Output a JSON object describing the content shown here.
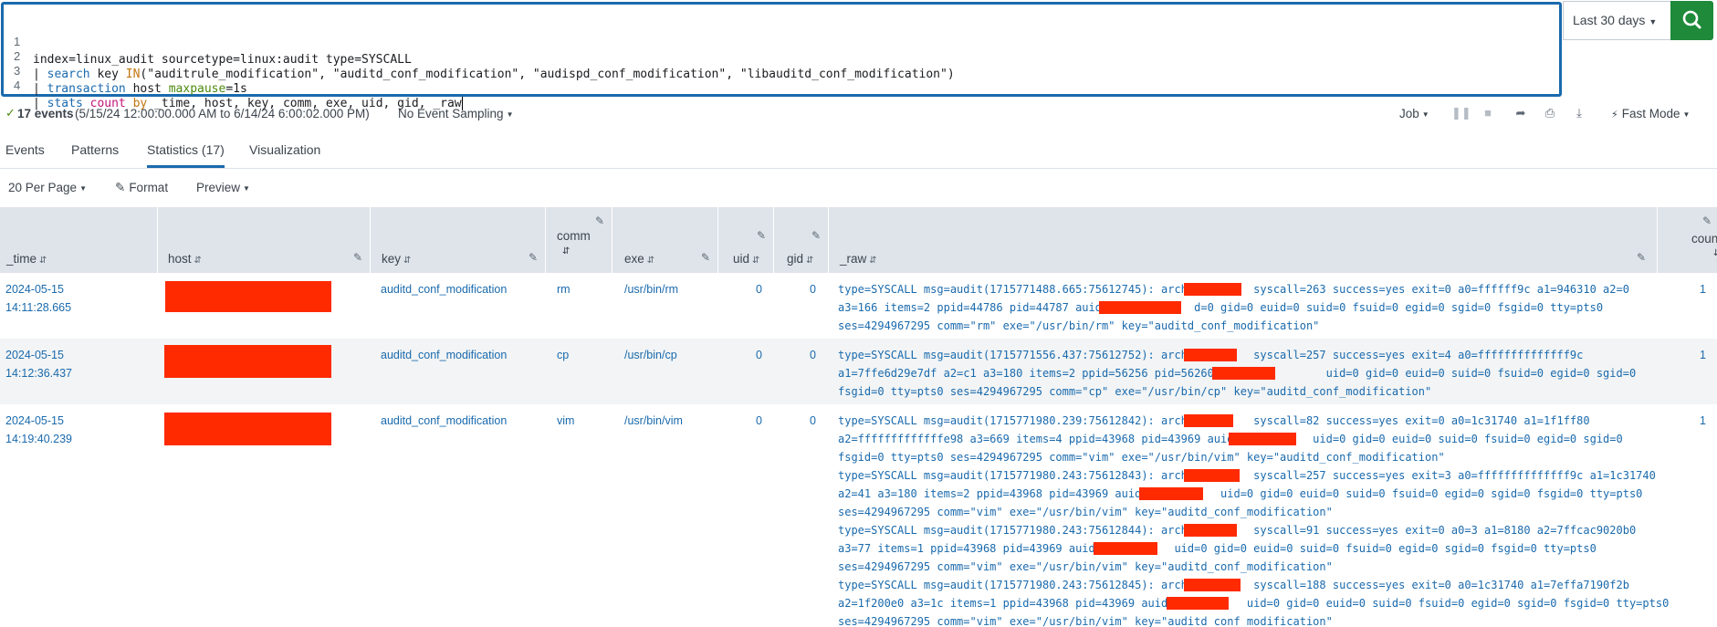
{
  "search": {
    "lines": [
      {
        "n": "1",
        "parts": [
          {
            "t": "index=linux_audit sourcetype=linux:audit type=SYSCALL",
            "c": ""
          }
        ]
      },
      {
        "n": "2",
        "parts": [
          {
            "t": "| ",
            "c": ""
          },
          {
            "t": "search",
            "c": "kw-blue"
          },
          {
            "t": " key ",
            "c": ""
          },
          {
            "t": "IN",
            "c": "kw-orange"
          },
          {
            "t": "(\"auditrule_modification\", \"auditd_conf_modification\", \"audispd_conf_modification\", \"libauditd_conf_modification\")",
            "c": ""
          }
        ]
      },
      {
        "n": "3",
        "parts": [
          {
            "t": "| ",
            "c": ""
          },
          {
            "t": "transaction",
            "c": "kw-blue"
          },
          {
            "t": " host ",
            "c": ""
          },
          {
            "t": "maxpause",
            "c": "kw-green"
          },
          {
            "t": "=1s",
            "c": ""
          }
        ]
      },
      {
        "n": "4",
        "parts": [
          {
            "t": "| ",
            "c": ""
          },
          {
            "t": "stats",
            "c": "kw-blue"
          },
          {
            "t": " ",
            "c": ""
          },
          {
            "t": "count",
            "c": "kw-pink"
          },
          {
            "t": " ",
            "c": ""
          },
          {
            "t": "by",
            "c": "kw-orange"
          },
          {
            "t": " _time, host, key, comm, exe, uid, gid, _raw",
            "c": ""
          }
        ]
      }
    ],
    "time_range_label": "Last 30 days",
    "search_icon": "search-icon"
  },
  "status": {
    "events_count": "17 events",
    "range_text": "(5/15/24 12:00:00.000 AM to 6/14/24 6:00:02.000 PM)",
    "sampling_label": "No Event Sampling",
    "job_label": "Job",
    "mode_label": "Fast Mode"
  },
  "tabs": [
    {
      "label": "Events",
      "active": false
    },
    {
      "label": "Patterns",
      "active": false
    },
    {
      "label": "Statistics (17)",
      "active": true
    },
    {
      "label": "Visualization",
      "active": false
    }
  ],
  "controls": {
    "per_page": "20 Per Page",
    "format": "Format",
    "preview": "Preview"
  },
  "table": {
    "columns": [
      "_time",
      "host",
      "key",
      "comm",
      "exe",
      "uid",
      "gid",
      "_raw",
      "count"
    ],
    "rows": [
      {
        "time": [
          "2024-05-15",
          "14:11:28.665"
        ],
        "key": "auditd_conf_modification",
        "comm": "rm",
        "exe": "/usr/bin/rm",
        "uid": "0",
        "gid": "0",
        "raw": [
          "type=SYSCALL msg=audit(1715771488.665:75612745): arch=         syscall=263 success=yes exit=0 a0=ffffff9c a1=946310 a2=0",
          "a3=166 items=2 ppid=44786 pid=44787 auid=             d=0 gid=0 euid=0 suid=0 fsuid=0 egid=0 sgid=0 fsgid=0 tty=pts0",
          "ses=4294967295 comm=\"rm\" exe=\"/usr/bin/rm\" key=\"auditd_conf_modification\""
        ],
        "count": "1"
      },
      {
        "time": [
          "2024-05-15",
          "14:12:36.437"
        ],
        "key": "auditd_conf_modification",
        "comm": "cp",
        "exe": "/usr/bin/cp",
        "uid": "0",
        "gid": "0",
        "raw": [
          "type=SYSCALL msg=audit(1715771556.437:75612752): arch=         syscall=257 success=yes exit=4 a0=ffffffffffffff9c",
          "a1=7ffe6d29e7df a2=c1 a3=180 items=2 ppid=56256 pid=56260 auid=           uid=0 gid=0 euid=0 suid=0 fsuid=0 egid=0 sgid=0",
          "fsgid=0 tty=pts0 ses=4294967295 comm=\"cp\" exe=\"/usr/bin/cp\" key=\"auditd_conf_modification\""
        ],
        "count": "1"
      },
      {
        "time": [
          "2024-05-15",
          "14:19:40.239"
        ],
        "key": "auditd_conf_modification",
        "comm": "vim",
        "exe": "/usr/bin/vim",
        "uid": "0",
        "gid": "0",
        "raw": [
          "type=SYSCALL msg=audit(1715771980.239:75612842): arch=         syscall=82 success=yes exit=0 a0=1c31740 a1=1f1ff80",
          "a2=fffffffffffffe98 a3=669 items=4 ppid=43968 pid=43969 auid=           uid=0 gid=0 euid=0 suid=0 fsuid=0 egid=0 sgid=0",
          "fsgid=0 tty=pts0 ses=4294967295 comm=\"vim\" exe=\"/usr/bin/vim\" key=\"auditd_conf_modification\"",
          "type=SYSCALL msg=audit(1715771980.243:75612843): arch=         syscall=257 success=yes exit=3 a0=ffffffffffffff9c a1=1c31740",
          "a2=41 a3=180 items=2 ppid=43968 pid=43969 auid=           uid=0 gid=0 euid=0 suid=0 fsuid=0 egid=0 sgid=0 fsgid=0 tty=pts0",
          "ses=4294967295 comm=\"vim\" exe=\"/usr/bin/vim\" key=\"auditd_conf_modification\"",
          "type=SYSCALL msg=audit(1715771980.243:75612844): arch=         syscall=91 success=yes exit=0 a0=3 a1=8180 a2=7ffcac9020b0",
          "a3=77 items=1 ppid=43968 pid=43969 auid=           uid=0 gid=0 euid=0 suid=0 fsuid=0 egid=0 sgid=0 fsgid=0 tty=pts0",
          "ses=4294967295 comm=\"vim\" exe=\"/usr/bin/vim\" key=\"auditd_conf_modification\"",
          "type=SYSCALL msg=audit(1715771980.243:75612845): arch=         syscall=188 success=yes exit=0 a0=1c31740 a1=7effa7190f2b",
          "a2=1f200e0 a3=1c items=1 ppid=43968 pid=43969 auid=           uid=0 gid=0 euid=0 suid=0 fsuid=0 egid=0 sgid=0 fsgid=0 tty=pts0",
          "ses=4294967295 comm=\"vim\" exe=\"/usr/bin/vim\" key=\"auditd_conf_modification\""
        ],
        "count": "1"
      }
    ]
  },
  "colors": {
    "accent": "#1a6aad",
    "search_green": "#1e8a3a",
    "redaction": "#ff2a00",
    "header_bg": "#dfe4ea"
  }
}
